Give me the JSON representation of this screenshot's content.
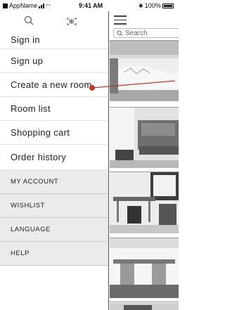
{
  "status_bar": {
    "carrier": "AppName",
    "time": "9:41 AM",
    "battery": "100%"
  },
  "drawer": {
    "menu_items": [
      {
        "label": "Sign in"
      },
      {
        "label": "Sign up"
      },
      {
        "label": "Create a new room"
      },
      {
        "label": "Room list"
      },
      {
        "label": "Shopping cart"
      },
      {
        "label": "Order history"
      }
    ],
    "sub_items": [
      {
        "label": "MY ACCOUNT"
      },
      {
        "label": "WISHLIST"
      },
      {
        "label": "LANGUAGE"
      },
      {
        "label": "HELP"
      }
    ]
  },
  "background_app": {
    "search_placeholder": "Search"
  },
  "icons": {
    "search": "search-icon",
    "scan": "barcode-scan-icon",
    "menu": "hamburger-menu-icon",
    "callout_dot_color": "#c0392b"
  }
}
